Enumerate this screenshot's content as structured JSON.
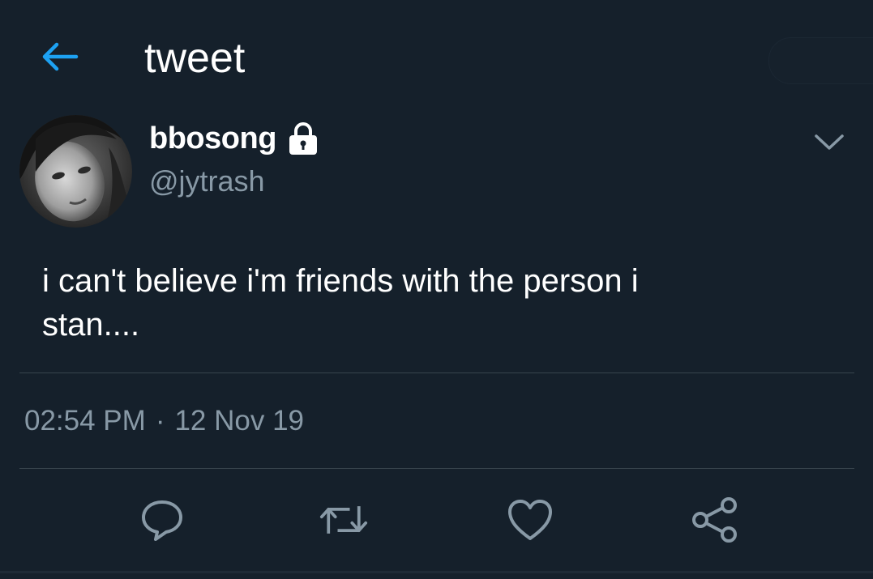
{
  "header": {
    "title": "tweet",
    "back_icon": "arrow-left-icon"
  },
  "author": {
    "display_name": "bbosong",
    "protected_icon": "lock-icon",
    "handle": "@jytrash"
  },
  "tweet": {
    "text": "i can't believe i'm friends with the person i\nstan...."
  },
  "meta": {
    "time": "02:54 PM",
    "separator": "·",
    "date": "12 Nov 19"
  },
  "actions": {
    "reply_icon": "reply-icon",
    "retweet_icon": "retweet-icon",
    "like_icon": "heart-icon",
    "share_icon": "share-icon"
  },
  "colors": {
    "background": "#15202b",
    "accent": "#1da1f2",
    "secondary_text": "#8899a6",
    "divider": "#38444d"
  }
}
